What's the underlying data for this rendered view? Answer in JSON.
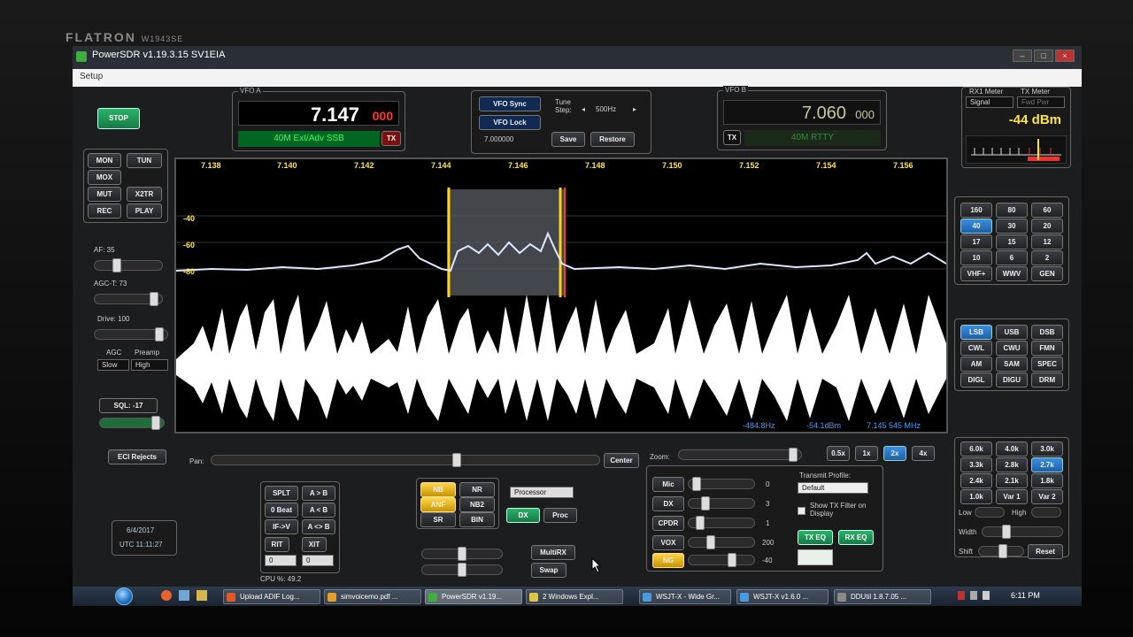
{
  "bezel": {
    "brand": "FLATRON",
    "model": "W1943SE"
  },
  "window": {
    "title": "PowerSDR v1.19.3.15 SV1EIA",
    "min": "–",
    "max": "□",
    "close": "×",
    "menu": "Setup"
  },
  "controls": {
    "stop": "STOP",
    "af": "AF: 35",
    "agc_t": "AGC-T: 73",
    "drive": "Drive: 100",
    "agc": "AGC",
    "preamp": "Preamp",
    "agc_mode": "Slow",
    "preamp_mode": "High",
    "sql": "SQL: -17",
    "eq": "ECI Rejects"
  },
  "mode_buttons": [
    "MON",
    "TUN",
    "MOX",
    "MUT",
    "X2TR",
    "REC",
    "PLAY"
  ],
  "vfo_a": {
    "label": "VFO A",
    "freq": "7.147",
    "sub": "000",
    "band": "40M Ext/Adv SSB",
    "tx": "TX"
  },
  "vfo_mid": {
    "sync": "VFO Sync",
    "lock": "VFO Lock",
    "tune_step_label": "Tune Step:",
    "tune_step": "500Hz",
    "save": "Save",
    "restore": "Restore",
    "mem_freq": "7.000000"
  },
  "vfo_b": {
    "label": "VFO B",
    "freq": "7.060",
    "sub": "000",
    "tx": "TX",
    "band": "40M RTTY"
  },
  "meter": {
    "rx1": "RX1 Meter",
    "tx": "TX Meter",
    "rx_mode": "Signal",
    "tx_mode": "Fwd Pwr",
    "value": "-44 dBm"
  },
  "display": {
    "freq_labels": [
      "7.138",
      "7.140",
      "7.142",
      "7.144",
      "7.146",
      "7.148",
      "7.150",
      "7.152",
      "7.154",
      "7.156"
    ],
    "db_labels": [
      "-40",
      "-60",
      "-80"
    ],
    "readout_offset": "-484.8Hz",
    "readout_dbm": "-54.1dBm",
    "readout_freq": "7.145 545 MHz"
  },
  "band_buttons": [
    "160",
    "80",
    "60",
    "40",
    "30",
    "20",
    "17",
    "15",
    "12",
    "10",
    "6",
    "2",
    "VHF+",
    "WWV",
    "GEN"
  ],
  "demod_buttons": [
    "LSB",
    "USB",
    "DSB",
    "CWL",
    "CWU",
    "FMN",
    "AM",
    "SAM",
    "SPEC",
    "DIGL",
    "DIGU",
    "DRM"
  ],
  "filter_buttons": [
    "6.0k",
    "4.0k",
    "3.0k",
    "3.3k",
    "2.8k",
    "2.7k",
    "2.4k",
    "2.1k",
    "1.8k",
    "1.0k",
    "Var 1",
    "Var 2"
  ],
  "filter": {
    "low": "Low",
    "high": "High",
    "width": "Width",
    "shift": "Shift",
    "reset": "Reset"
  },
  "zoom": {
    "pan": "Pan:",
    "center": "Center",
    "zoom": "Zoom:",
    "buttons": [
      "0.5x",
      "1x",
      "2x",
      "4x"
    ]
  },
  "split": {
    "buttons": [
      "SPLT",
      "A > B",
      "0 Beat",
      "A < B",
      "IF->V",
      "A <> B",
      "RIT",
      "XIT"
    ],
    "rit_value": "0",
    "xit_value": "0",
    "cpu": "CPU %: 49.2"
  },
  "clock": {
    "date": "6/4/2017",
    "time": "UTC 11:11:27"
  },
  "mid": {
    "buttons": [
      "NB",
      "NR",
      "ANF",
      "NB2",
      "SR",
      "BIN"
    ],
    "processor": "Processor",
    "dx": "DX",
    "proc": "Proc",
    "multirx": "MultiRX",
    "swap": "Swap"
  },
  "tx": {
    "mic": "Mic",
    "dx": "DX",
    "cpdr": "CPDR",
    "vox": "VOX",
    "noise_gate": "NG",
    "mic_val": "0",
    "dx_val": "3",
    "cpdr_val": "1",
    "vox_val": "200",
    "ng_val": "-40",
    "profile_label": "Transmit Profile:",
    "profile": "Default",
    "show_tx": "Show TX Filter on Display",
    "tx_eq": "TX EQ",
    "rx_eq": "RX EQ"
  },
  "taskbar": {
    "items": [
      {
        "label": "Upload ADIF Log...",
        "color": "#e05a2a"
      },
      {
        "label": "simvoicemo.pdf ...",
        "color": "#e0a02a"
      },
      {
        "label": "PowerSDR v1.19...",
        "color": "#3fae3f"
      },
      {
        "label": "2 Windows Expl...",
        "color": "#e0c44a"
      },
      {
        "label": "WSJT-X - Wide Gr...",
        "color": "#4a9ae0"
      },
      {
        "label": "WSJT-X  v1.6.0 ...",
        "color": "#4a9ae0"
      },
      {
        "label": "DDUtil 1.8.7.05 ...",
        "color": "#8a8a8a"
      }
    ],
    "time": "6:11 PM"
  }
}
